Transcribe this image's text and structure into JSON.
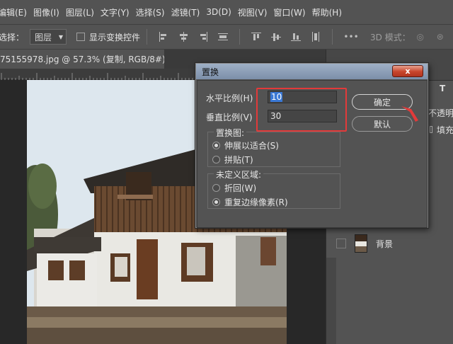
{
  "menu": [
    "编辑(E)",
    "图像(I)",
    "图层(L)",
    "文字(Y)",
    "选择(S)",
    "滤镜(T)",
    "3D(D)",
    "视图(V)",
    "窗口(W)",
    "帮助(H)"
  ],
  "options": {
    "select_label": "选择：",
    "select_value": "图层",
    "show_transform": "显示变换控件",
    "more": "•••",
    "mode_3d": "3D 模式："
  },
  "document": {
    "tab_title": "75155978.jpg @ 57.3% (复制, RGB/8#) *",
    "tab_close": "×"
  },
  "right_panel": {
    "opacity_label": "不透明度",
    "fill_label": "填充",
    "layer_name": "背景"
  },
  "dialog": {
    "title": "置换",
    "close": "x",
    "horizontal_label": "水平比例(H)",
    "horizontal_value": "10",
    "vertical_label": "垂直比例(V)",
    "vertical_value": "30",
    "map_group": "置换图:",
    "stretch": "伸展以适合(S)",
    "tile": "拼贴(T)",
    "undefined_group": "未定义区域:",
    "wrap": "折回(W)",
    "repeat_edge": "重复边缘像素(R)",
    "ok": "确定",
    "default": "默认",
    "map_selected": "stretch",
    "undefined_selected": "repeat_edge"
  },
  "colors": {
    "highlight_box": "#e23a3a",
    "selection": "#3978d5"
  }
}
